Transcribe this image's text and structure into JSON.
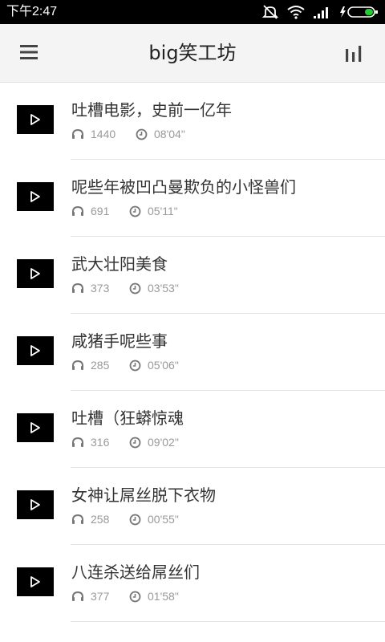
{
  "status_bar": {
    "time": "下午2:47"
  },
  "header": {
    "title": "big笑工坊"
  },
  "episodes": [
    {
      "title": "吐槽电影，史前一亿年",
      "listens": "1440",
      "duration": "08'04\""
    },
    {
      "title": "呢些年被凹凸曼欺负的小怪兽们",
      "listens": "691",
      "duration": "05'11\""
    },
    {
      "title": "武大壮阳美食",
      "listens": "373",
      "duration": "03'53\""
    },
    {
      "title": "咸猪手呢些事",
      "listens": "285",
      "duration": "05'06\""
    },
    {
      "title": "吐槽（狂蟒惊魂",
      "listens": "316",
      "duration": "09'02\""
    },
    {
      "title": "女神让屌丝脱下衣物",
      "listens": "258",
      "duration": "00'55\""
    },
    {
      "title": "八连杀送给屌丝们",
      "listens": "377",
      "duration": "01'58\""
    }
  ],
  "colors": {
    "status_bar_bg": "#000000",
    "header_bg": "#f4f4f4",
    "play_button_bg": "#000000",
    "meta_text": "#999999",
    "battery_accent": "#22cc33"
  },
  "icons": {
    "menu": "hamburger-menu-icon",
    "chart": "bar-chart-icon",
    "play": "play-icon",
    "listens": "headphones-icon",
    "duration": "clock-icon"
  }
}
